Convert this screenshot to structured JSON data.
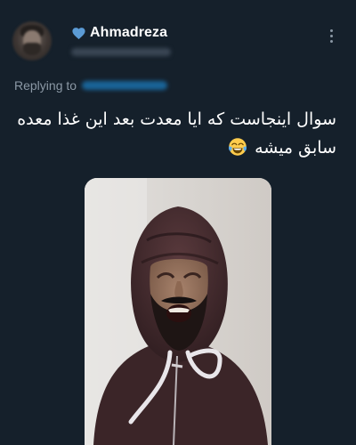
{
  "tweet": {
    "author": {
      "display_name": "Ahmadreza",
      "avatar_icon": "profile-avatar",
      "badge_icon": "blue-heart-icon",
      "badge_color": "#5b9bd5"
    },
    "reply_label": "Replying to",
    "text_line_1": "سوال اینجاست که ایا معدت بعد این غذا معده",
    "text_line_2": "سابق میشه",
    "emoji_icon": "face-with-tears-of-joy-icon",
    "more_icon": "more-options-icon",
    "media": {
      "kind": "photo",
      "subject": "man-in-hood-photo"
    }
  },
  "colors": {
    "background": "#15202b",
    "text_primary": "#ffffff",
    "text_secondary": "#8b98a5",
    "link": "#1d9bf0"
  }
}
